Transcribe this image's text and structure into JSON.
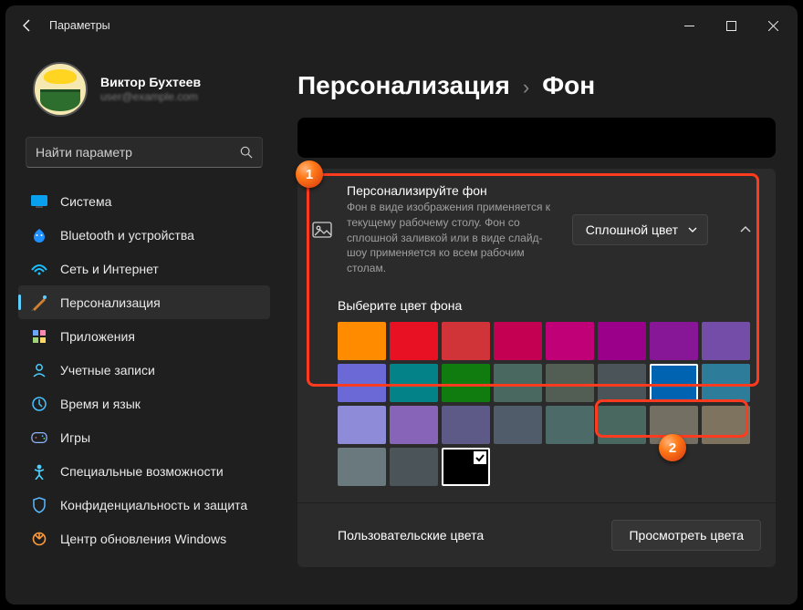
{
  "window": {
    "title": "Параметры",
    "user_name": "Виктор Бухтеев",
    "user_email": "user@example.com",
    "search_placeholder": "Найти параметр"
  },
  "sidebar": {
    "items": [
      {
        "label": "Система"
      },
      {
        "label": "Bluetooth и устройства"
      },
      {
        "label": "Сеть и Интернет"
      },
      {
        "label": "Персонализация"
      },
      {
        "label": "Приложения"
      },
      {
        "label": "Учетные записи"
      },
      {
        "label": "Время и язык"
      },
      {
        "label": "Игры"
      },
      {
        "label": "Специальные возможности"
      },
      {
        "label": "Конфиденциальность и защита"
      },
      {
        "label": "Центр обновления Windows"
      }
    ],
    "active_index": 3
  },
  "breadcrumb": {
    "root": "Персонализация",
    "leaf": "Фон"
  },
  "background_card": {
    "title": "Персонализируйте фон",
    "description": "Фон в виде изображения применяется к текущему рабочему столу. Фон со сплошной заливкой или в виде слайд-шоу применяется ко всем рабочим столам.",
    "dropdown_value": "Сплошной цвет"
  },
  "colors_section": {
    "label": "Выберите цвет фона",
    "swatches": [
      "#ff8c00",
      "#e81123",
      "#d13438",
      "#c30052",
      "#bf0077",
      "#9a0089",
      "#881798",
      "#744da9",
      "#6b69d6",
      "#038387",
      "#107c10",
      "#486860",
      "#525e54",
      "#4a5459",
      "#0063b1",
      "#2d7d9a",
      "#8e8cd8",
      "#8764b8",
      "#5d5a88",
      "#515c6b",
      "#4c6b68",
      "#486860",
      "#746f63",
      "#7e735f",
      "#69797e",
      "#4a5459",
      "#000000"
    ],
    "hover_index": 14,
    "selected_index": 26
  },
  "custom_colors": {
    "label": "Пользовательские цвета",
    "button_label": "Просмотреть цвета"
  },
  "annotations": {
    "badge1": "1",
    "badge2": "2"
  }
}
